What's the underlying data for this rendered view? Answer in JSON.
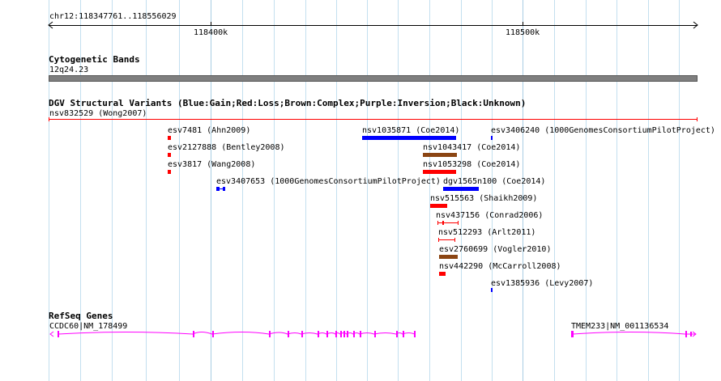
{
  "ruler": {
    "location": "chr12:118347761..118556029",
    "tick_400k": "118400k",
    "tick_500k": "118500k"
  },
  "cytobands": {
    "title": "Cytogenetic Bands",
    "band": "12q24.23"
  },
  "dgv": {
    "title": "DGV Structural Variants (Blue:Gain;Red:Loss;Brown:Complex;Purple:Inversion;Black:Unknown)",
    "colors": {
      "gain": "#0000ff",
      "loss": "#ff0000",
      "complex": "#8b4513",
      "inversion": "#800080",
      "unknown": "#000000"
    },
    "features": [
      {
        "label": "nsv832529 (Wong2007)",
        "type": "loss"
      },
      {
        "label": "esv7481 (Ahn2009)",
        "type": "loss"
      },
      {
        "label": "nsv1035871 (Coe2014)",
        "type": "gain"
      },
      {
        "label": "esv3406240 (1000GenomesConsortiumPilotProject)",
        "type": "gain"
      },
      {
        "label": "esv2127888 (Bentley2008)",
        "type": "loss"
      },
      {
        "label": "nsv1043417 (Coe2014)",
        "type": "complex"
      },
      {
        "label": "esv3817 (Wang2008)",
        "type": "loss"
      },
      {
        "label": "nsv1053298 (Coe2014)",
        "type": "loss"
      },
      {
        "label": "esv3407653 (1000GenomesConsortiumPilotProject)",
        "type": "gain"
      },
      {
        "label": "dgv1565n100 (Coe2014)",
        "type": "gain"
      },
      {
        "label": "nsv515563 (Shaikh2009)",
        "type": "loss"
      },
      {
        "label": "nsv437156 (Conrad2006)",
        "type": "loss"
      },
      {
        "label": "nsv512293 (Arlt2011)",
        "type": "loss"
      },
      {
        "label": "esv2760699 (Vogler2010)",
        "type": "complex"
      },
      {
        "label": "nsv442290 (McCarroll2008)",
        "type": "loss"
      },
      {
        "label": "esv1385936 (Levy2007)",
        "type": "gain"
      }
    ]
  },
  "refseq": {
    "title": "RefSeq Genes",
    "color": "#ff00ff",
    "genes": [
      {
        "label": "CCDC60|NM_178499"
      },
      {
        "label": "TMEM233|NM_001136534"
      }
    ]
  }
}
